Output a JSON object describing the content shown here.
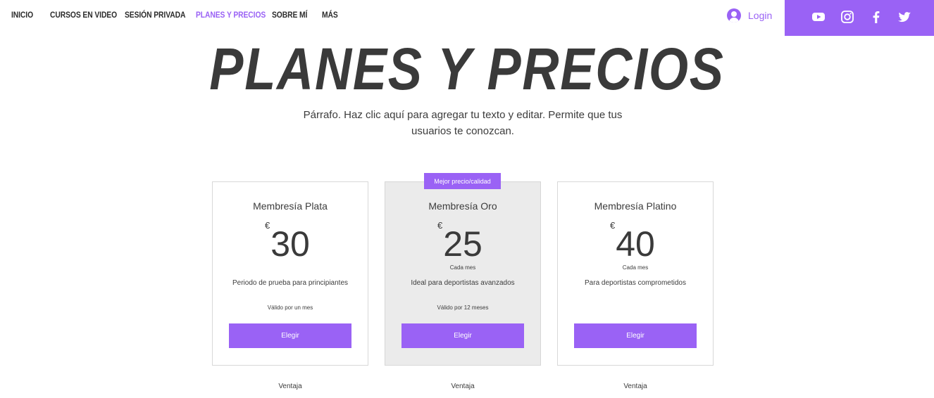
{
  "nav": {
    "items": [
      {
        "label": "INICIO",
        "active": false
      },
      {
        "label": "CURSOS EN VIDEO",
        "active": false
      },
      {
        "label": "SESIÓN PRIVADA",
        "active": false
      },
      {
        "label": "PLANES Y PRECIOS",
        "active": true
      },
      {
        "label": "SOBRE MÍ",
        "active": false
      },
      {
        "label": "MÁS",
        "active": false
      }
    ],
    "login_label": "Login"
  },
  "social": [
    "youtube-icon",
    "instagram-icon",
    "facebook-icon",
    "twitter-icon"
  ],
  "hero": {
    "title": "PLANES Y PRECIOS",
    "text": "Párrafo. Haz clic aquí para agregar tu texto y editar. Permite que tus usuarios te conozcan."
  },
  "plans": [
    {
      "name": "Membresía Plata",
      "currency": "€",
      "price": "30",
      "period": "",
      "description": "Periodo de prueba para principiantes",
      "validity": "Válido por un mes",
      "button": "Elegir",
      "benefit": "Ventaja"
    },
    {
      "name": "Membresía Oro",
      "currency": "€",
      "price": "25",
      "period": "Cada mes",
      "description": "Ideal para deportistas avanzados",
      "validity": "Válido por 12 meses",
      "button": "Elegir",
      "benefit": "Ventaja"
    },
    {
      "name": "Membresía Platino",
      "currency": "€",
      "price": "40",
      "period": "Cada mes",
      "description": "Para deportistas comprometidos",
      "validity": "",
      "button": "Elegir",
      "benefit": "Ventaja"
    }
  ],
  "badge": "Mejor precio/calidad",
  "colors": {
    "accent": "#9a62f5",
    "text": "#3c3c3c",
    "featured_bg": "#ebebeb"
  }
}
